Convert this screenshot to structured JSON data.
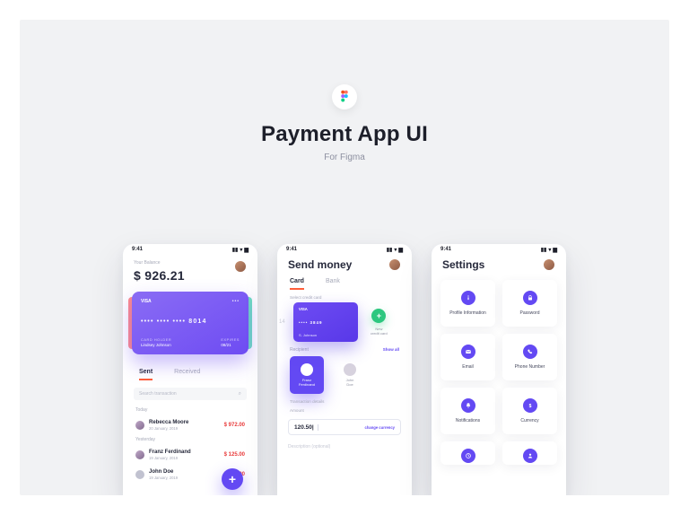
{
  "header": {
    "title": "Payment App UI",
    "subtitle": "For Figma"
  },
  "status": {
    "time": "9:41"
  },
  "balance": {
    "label": "Your Balance",
    "value": "$ 926.21"
  },
  "card": {
    "brand": "VISA",
    "number": "•••• •••• •••• 8014",
    "holder_label": "CARD HOLDER",
    "holder": "Lindsey Johnson",
    "exp_label": "EXPIRES",
    "exp": "08/21"
  },
  "p1": {
    "tab_sent": "Sent",
    "tab_received": "Received",
    "search_placeholder": "Search transaction",
    "grp1": "Today",
    "grp2": "Yesterday",
    "tx": [
      {
        "name": "Rebecca Moore",
        "date": "20 January, 2019",
        "amount": "$ 972.00"
      },
      {
        "name": "Franz Ferdinand",
        "date": "19 January, 2019",
        "amount": "$ 125.00"
      },
      {
        "name": "John Doe",
        "date": "19 January, 2019",
        "amount": "$ 243.00"
      }
    ]
  },
  "p2": {
    "title": "Send money",
    "tab_card": "Card",
    "tab_bank": "Bank",
    "select_label": "Select credit card",
    "mini_brand": "VISA",
    "mini_number": "•••• 3849",
    "mini_holder": "S. Johnson",
    "bg_last4": "14",
    "new_card": "New\ncredit card",
    "recipient_label": "Recipient",
    "show_all": "Show all",
    "rec1": "Franz\nFerdinand",
    "rec2": "John\nDoe",
    "details_label": "Transaction details",
    "amount_label": "Amount",
    "amount_value": "120.50",
    "cursor": "|",
    "change_currency": "change currency",
    "desc_label": "Description",
    "desc_hint": "(optional)"
  },
  "p3": {
    "title": "Settings",
    "tiles": [
      "Profile Information",
      "Password",
      "Email",
      "Phone Number",
      "Notifications",
      "Currency"
    ]
  }
}
